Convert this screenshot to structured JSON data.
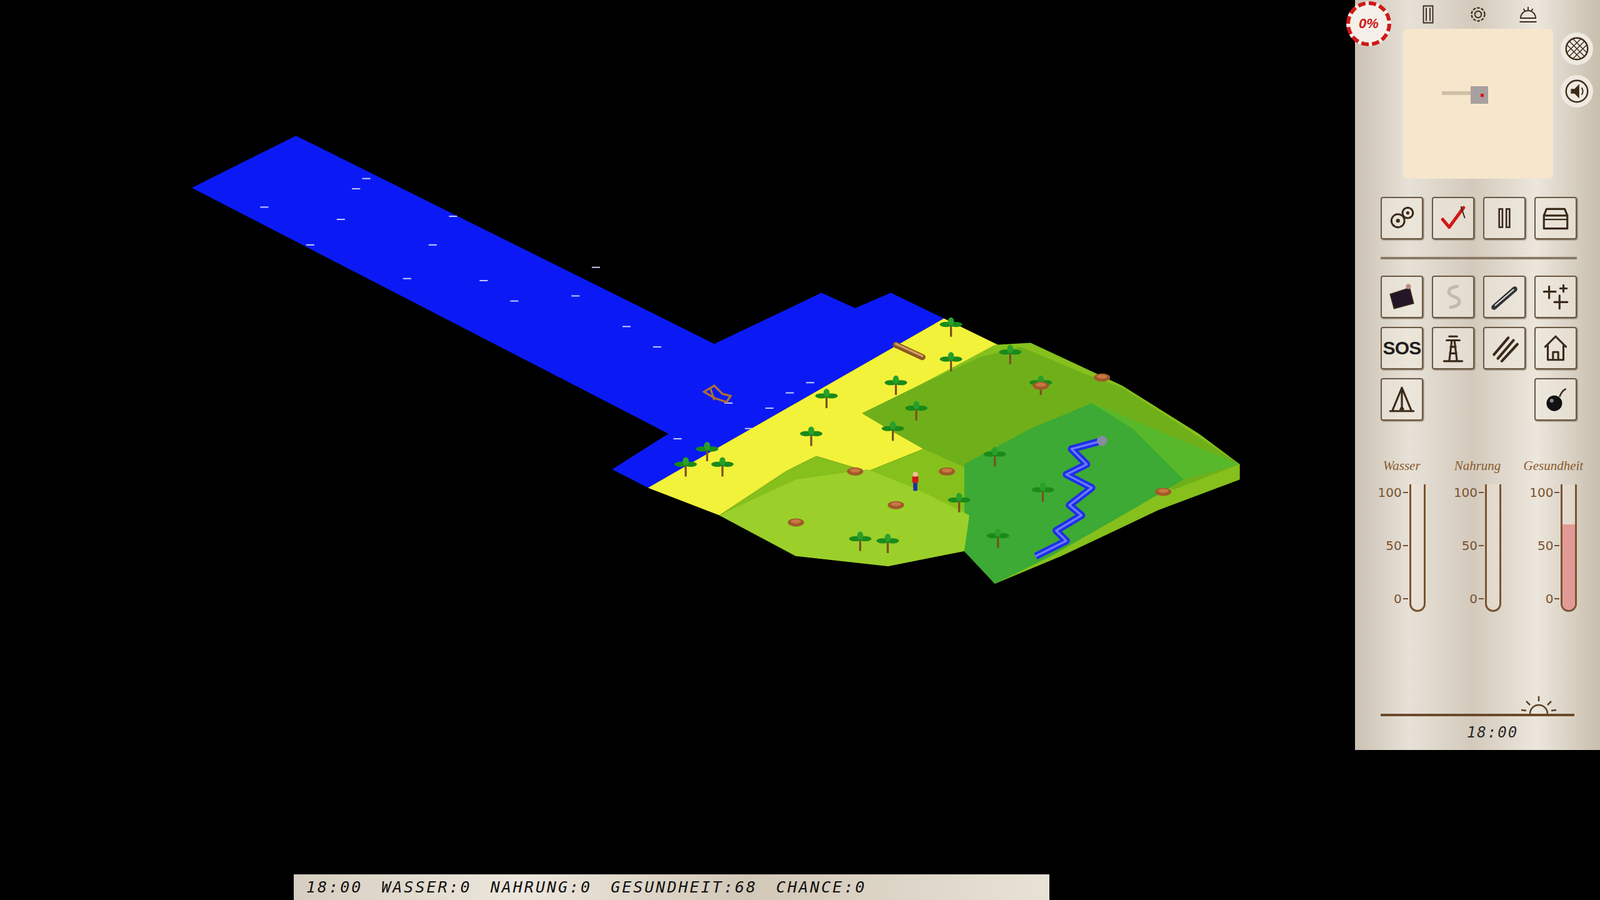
{
  "hud": {
    "progress": "0%",
    "top_buttons": [
      {
        "kind": "door"
      },
      {
        "kind": "ring"
      },
      {
        "kind": "eye"
      }
    ],
    "side_buttons": [
      {
        "kind": "net"
      },
      {
        "kind": "sound"
      }
    ]
  },
  "tools": [
    [
      {
        "kind": "gears",
        "label": "",
        "disabled": false
      },
      {
        "kind": "check",
        "label": "",
        "disabled": false
      },
      {
        "kind": "pause",
        "label": "",
        "disabled": false
      },
      {
        "kind": "chest",
        "label": "",
        "disabled": false
      }
    ],
    [
      {
        "kind": "cloth",
        "label": "",
        "disabled": false
      },
      {
        "kind": "rope",
        "label": "",
        "disabled": true
      },
      {
        "kind": "stick",
        "label": "",
        "disabled": false
      },
      {
        "kind": "cross",
        "label": "",
        "disabled": false
      }
    ],
    [
      {
        "kind": "text",
        "label": "SOS",
        "disabled": false
      },
      {
        "kind": "tower",
        "label": "",
        "disabled": false
      },
      {
        "kind": "planks",
        "label": "",
        "disabled": false
      },
      {
        "kind": "hut",
        "label": "",
        "disabled": false
      }
    ],
    [
      {
        "kind": "fire",
        "label": "",
        "disabled": false
      },
      {
        "kind": "empty",
        "label": "",
        "disabled": false
      },
      {
        "kind": "empty",
        "label": "",
        "disabled": false
      },
      {
        "kind": "bomb",
        "label": "",
        "disabled": false
      }
    ]
  ],
  "gauges": [
    {
      "label": "Wasser",
      "level": 0,
      "ticks": [
        "100",
        "50",
        "0"
      ]
    },
    {
      "label": "Nahrung",
      "level": 0,
      "ticks": [
        "100",
        "50",
        "0"
      ]
    },
    {
      "label": "Gesundheit",
      "level": 0.68,
      "ticks": [
        "100",
        "50",
        "0"
      ]
    }
  ],
  "clock": "18:00",
  "status_bar": {
    "items": [
      "18:00",
      "WASSER:0",
      "NAHRUNG:0",
      "GESUNDHEIT:68",
      "CHANCE:0"
    ]
  }
}
